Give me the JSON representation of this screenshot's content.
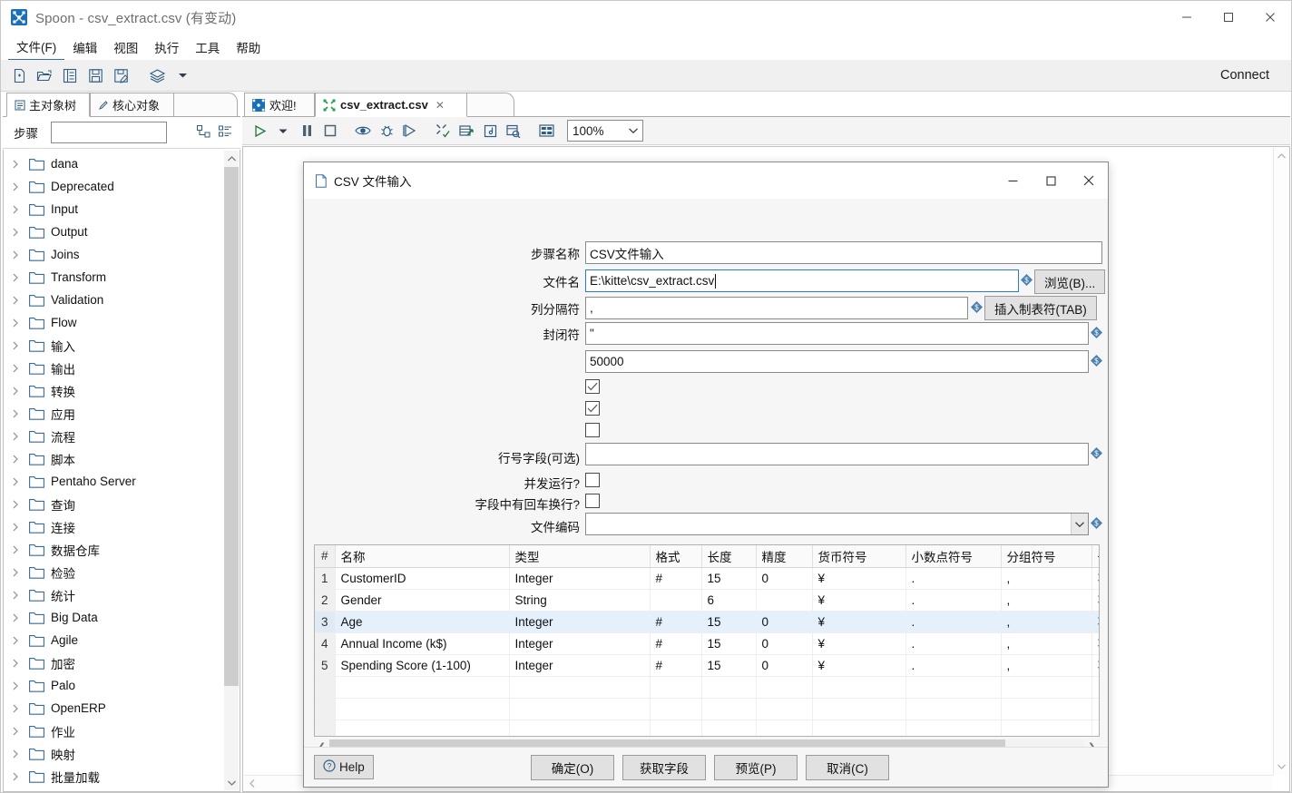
{
  "window": {
    "title": "Spoon - csv_extract.csv (有变动)",
    "app_icon": "spoon-icon",
    "minimize": "–",
    "maximize": "□",
    "close": "✕"
  },
  "menubar": {
    "items": [
      {
        "label": "文件(F)",
        "active": true
      },
      {
        "label": "编辑",
        "active": false
      },
      {
        "label": "视图",
        "active": false
      },
      {
        "label": "执行",
        "active": false
      },
      {
        "label": "工具",
        "active": false
      },
      {
        "label": "帮助",
        "active": false
      }
    ]
  },
  "toolbar": {
    "icons": [
      "new-file-icon",
      "open-folder-icon",
      "explorer-icon",
      "save-icon",
      "save-as-icon",
      "layers-icon",
      "dropdown-arrow-icon"
    ],
    "connect_label": "Connect"
  },
  "left_panel": {
    "tabs": [
      {
        "label": "主对象树",
        "icon": "tree-view-icon",
        "selected": true
      },
      {
        "label": "核心对象",
        "icon": "pencil-icon",
        "selected": false
      }
    ],
    "search": {
      "label": "步骤",
      "value": "",
      "placeholder": "",
      "icons": [
        "expand-all-icon",
        "collapse-all-icon"
      ]
    },
    "tree_items": [
      {
        "label": "dana"
      },
      {
        "label": "Deprecated"
      },
      {
        "label": "Input"
      },
      {
        "label": "Output"
      },
      {
        "label": "Joins"
      },
      {
        "label": "Transform"
      },
      {
        "label": "Validation"
      },
      {
        "label": "Flow"
      },
      {
        "label": "输入"
      },
      {
        "label": "输出"
      },
      {
        "label": "转换"
      },
      {
        "label": "应用"
      },
      {
        "label": "流程"
      },
      {
        "label": "脚本"
      },
      {
        "label": "Pentaho Server"
      },
      {
        "label": "查询"
      },
      {
        "label": "连接"
      },
      {
        "label": "数据仓库"
      },
      {
        "label": "检验"
      },
      {
        "label": "统计"
      },
      {
        "label": "Big Data"
      },
      {
        "label": "Agile"
      },
      {
        "label": "加密"
      },
      {
        "label": "Palo"
      },
      {
        "label": "OpenERP"
      },
      {
        "label": "作业"
      },
      {
        "label": "映射"
      },
      {
        "label": "批量加载"
      }
    ]
  },
  "editor": {
    "tabs": [
      {
        "label": "欢迎!",
        "icon": "welcome-icon",
        "selected": false,
        "closable": false
      },
      {
        "label": "csv_extract.csv",
        "icon": "transformation-icon",
        "selected": true,
        "closable": true
      }
    ],
    "canvas_toolbar": {
      "icons": [
        "run-icon",
        "run-options-arrow-icon",
        "pause-icon",
        "stop-icon",
        "preview-icon",
        "debug-icon",
        "replay-icon",
        "verify-icon",
        "analyze-icon",
        "impact-icon",
        "sql-icon",
        "grid-icon"
      ],
      "zoom_value": "100%",
      "zoom_chevron": "⌄"
    }
  },
  "dialog": {
    "title": "CSV 文件输入",
    "title_icon": "file-document-icon",
    "minimize": "–",
    "maximize": "□",
    "close": "✕",
    "fields": {
      "step_name": {
        "label": "步骤名称",
        "value": "CSV文件输入"
      },
      "file_name": {
        "label": "文件名",
        "value": "E:\\kitte\\csv_extract.csv",
        "browse_button": "浏览(B)...",
        "browse_mnemonic": "B"
      },
      "delimiter": {
        "label": "列分隔符",
        "value": ",",
        "insert_tab_button": "插入制表符(TAB)",
        "insert_tab_mnemonic": "T"
      },
      "enclosure": {
        "label": "封闭符",
        "value": "\""
      },
      "buffer_size": {
        "label": "",
        "value": "50000"
      },
      "lazy_conversion": {
        "label": "",
        "checked": true
      },
      "header_row": {
        "label": "",
        "checked": true
      },
      "add_filename": {
        "label": "",
        "checked": false
      },
      "row_number_field": {
        "label": "行号字段(可选)",
        "value": ""
      },
      "running_parallel": {
        "label": "并发运行?",
        "checked": false
      },
      "newline_in_field": {
        "label": "字段中有回车换行?",
        "checked": false
      },
      "file_encoding": {
        "label": "文件编码",
        "value": ""
      }
    },
    "table": {
      "columns": [
        "#",
        "名称",
        "类型",
        "格式",
        "长度",
        "精度",
        "货币符号",
        "小数点符号",
        "分组符号",
        "去除空字符串方式"
      ],
      "rows": [
        {
          "num": "1",
          "name": "CustomerID",
          "type": "Integer",
          "format": "#",
          "length": "15",
          "precision": "0",
          "currency": "¥",
          "decimal": ".",
          "group": ",",
          "trim": "不去掉空格",
          "selected": false
        },
        {
          "num": "2",
          "name": "Gender",
          "type": "String",
          "format": "",
          "length": "6",
          "precision": "",
          "currency": "¥",
          "decimal": ".",
          "group": ",",
          "trim": "不去掉空格",
          "selected": false
        },
        {
          "num": "3",
          "name": "Age",
          "type": "Integer",
          "format": "#",
          "length": "15",
          "precision": "0",
          "currency": "¥",
          "decimal": ".",
          "group": ",",
          "trim": "不去掉空格",
          "selected": true
        },
        {
          "num": "4",
          "name": "Annual Income (k$)",
          "type": "Integer",
          "format": "#",
          "length": "15",
          "precision": "0",
          "currency": "¥",
          "decimal": ".",
          "group": ",",
          "trim": "不去掉空格",
          "selected": false
        },
        {
          "num": "5",
          "name": "Spending Score (1-100)",
          "type": "Integer",
          "format": "#",
          "length": "15",
          "precision": "0",
          "currency": "¥",
          "decimal": ".",
          "group": ",",
          "trim": "不去掉空格",
          "selected": false
        },
        {
          "num": "",
          "name": "",
          "type": "",
          "format": "",
          "length": "",
          "precision": "",
          "currency": "",
          "decimal": "",
          "group": "",
          "trim": "",
          "selected": false
        },
        {
          "num": "",
          "name": "",
          "type": "",
          "format": "",
          "length": "",
          "precision": "",
          "currency": "",
          "decimal": "",
          "group": "",
          "trim": "",
          "selected": false
        },
        {
          "num": "",
          "name": "",
          "type": "",
          "format": "",
          "length": "",
          "precision": "",
          "currency": "",
          "decimal": "",
          "group": "",
          "trim": "",
          "selected": false
        },
        {
          "num": "",
          "name": "",
          "type": "",
          "format": "",
          "length": "",
          "precision": "",
          "currency": "",
          "decimal": "",
          "group": "",
          "trim": "",
          "selected": false
        }
      ]
    },
    "footer": {
      "help": "Help",
      "ok": "确定(O)",
      "ok_mnemonic": "O",
      "get_fields": "获取字段",
      "preview": "预览(P)",
      "preview_mnemonic": "P",
      "cancel": "取消(C)",
      "cancel_mnemonic": "C"
    }
  },
  "colors": {
    "accent": "#3a6ea5",
    "selection": "#e4f0fb",
    "toolbar_bg": "#f0f0f0",
    "dialog_bg": "#f6f6f6",
    "focus_border": "#2a7ad2"
  }
}
